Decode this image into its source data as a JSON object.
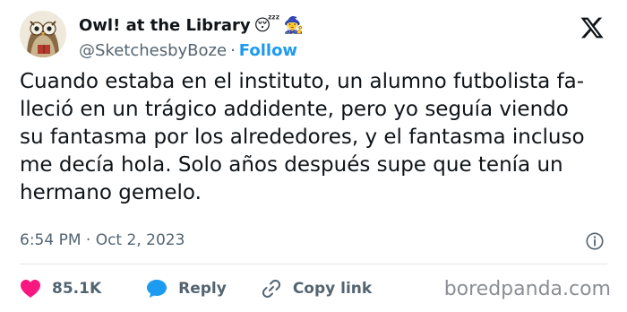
{
  "author": {
    "name": "Owl! at the Library",
    "emojis": [
      "😴",
      "🧙‍♀️"
    ],
    "handle": "@SketchesbyBoze",
    "separator": "·",
    "follow_label": "Follow"
  },
  "tweet": {
    "lines": [
      "Cuando estaba en el instituto, un alumno futbolista fa-",
      "lleció en un trágico addidente, pero yo seguía viendo",
      "su fantasma por los alrededores, y el fantasma incluso",
      "me decía hola. Solo años después supe que tenía un",
      "hermano gemelo."
    ],
    "timestamp": "6:54 PM · Oct 2, 2023"
  },
  "actions": {
    "likes_count": "85.1K",
    "reply_label": "Reply",
    "copy_link_label": "Copy link"
  },
  "watermark": "boredpanda.com",
  "colors": {
    "accent": "#1d9bf0",
    "like": "#f91880",
    "text": "#0f1419",
    "muted": "#536471"
  },
  "icons": [
    "owl-avatar",
    "x-logo-icon",
    "info-icon",
    "heart-icon",
    "reply-bubble-icon",
    "link-icon"
  ]
}
